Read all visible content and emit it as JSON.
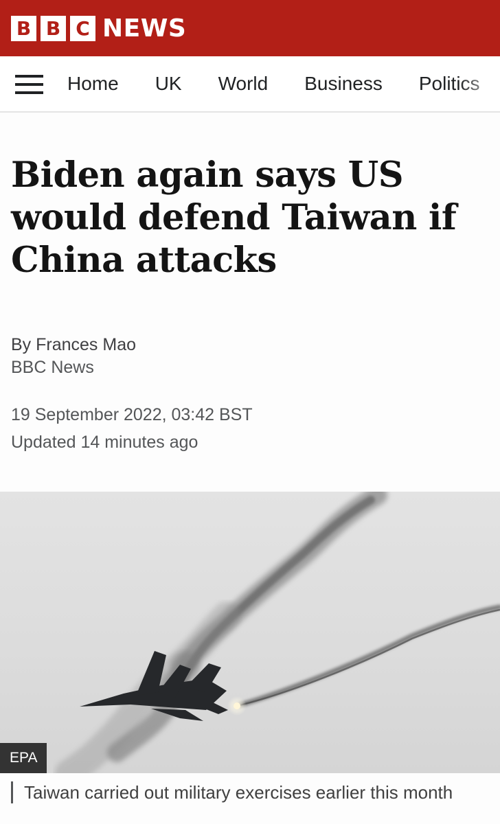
{
  "brand": {
    "letters": [
      "B",
      "B",
      "C"
    ],
    "name": "NEWS",
    "color": "#b21f17"
  },
  "nav": {
    "menu_icon": "hamburger-menu-icon",
    "items": [
      "Home",
      "UK",
      "World",
      "Business",
      "Politics"
    ]
  },
  "article": {
    "headline": "Biden again says US would defend Taiwan if China attacks",
    "author": "By Frances Mao",
    "source": "BBC News",
    "published": "19 September 2022, 03:42 BST",
    "updated": "Updated 14 minutes ago"
  },
  "image": {
    "credit": "EPA",
    "caption": "Taiwan carried out military exercises earlier this month"
  }
}
